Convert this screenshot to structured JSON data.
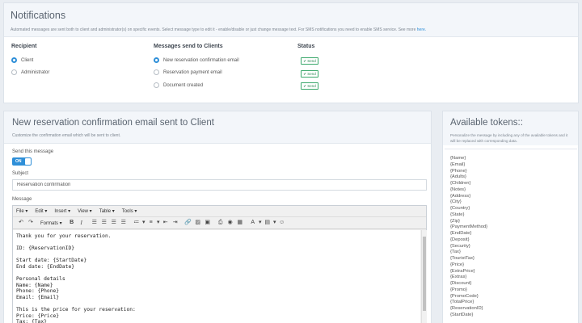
{
  "notifications": {
    "title": "Notifications",
    "description": "Automated messages are sent both to client and administrator(s) on specific events. Select message type to edit it - enable/disable or just change message text. For SMS notifications you need to enable SMS service. See more ",
    "link_text": "here.",
    "recipient_title": "Recipient",
    "recipients": [
      "Client",
      "Administrator"
    ],
    "selected_recipient": "Client",
    "messages_title": "Messages send to Clients",
    "messages": [
      "New reservation confirmation email",
      "Reservation payment email",
      "Document created"
    ],
    "selected_message": "New reservation confirmation email",
    "status_title": "Status",
    "status_label": "✔ Send"
  },
  "editor": {
    "title": "New reservation confirmation email sent to Client",
    "description": "Customize the confirmation email which will be sent to client.",
    "send_label": "Send this message",
    "toggle_label": "ON",
    "toggle_on": true,
    "subject_label": "Subject",
    "subject_value": "Reservation confirmation",
    "message_label": "Message",
    "menus": [
      "File",
      "Edit",
      "Insert",
      "View",
      "Table",
      "Tools"
    ],
    "formats_label": "Formats",
    "body_lines": [
      "Thank you for your reservation.",
      "",
      "ID: {ReservationID}",
      "",
      "Start date: {StartDate}",
      "End date: {EndDate}",
      "",
      "Personal details",
      "Name: {Name}",
      "Phone: {Phone}",
      "Email: {Email}",
      "",
      "This is the price for your reservation:",
      "Price: {Price}",
      "Tax: {Tax}"
    ]
  },
  "tokens": {
    "title": "Available tokens::",
    "description": "Personalize the message by including any of the available tokens and it will be replaced with corresponding data.",
    "items": [
      "{Name}",
      "{Email}",
      "{Phone}",
      "{Adults}",
      "{Children}",
      "{Notes}",
      "{Address}",
      "{City}",
      "{Country}",
      "{State}",
      "{Zip}",
      "{PaymentMethod}",
      "{EndDate}",
      "{Deposit}",
      "{Security}",
      "{Tax}",
      "{TouristTax}",
      "{Price}",
      "{ExtraPrice}",
      "{Extras}",
      "{Discount}",
      "{Promo}",
      "{PromoCode}",
      "{TotalPrice}",
      "{ReservationID}",
      "{StartDate}"
    ]
  },
  "colors": {
    "accent": "#2f8fd8",
    "status_green": "#3aa86b",
    "header_bg": "#f3f6fa"
  }
}
